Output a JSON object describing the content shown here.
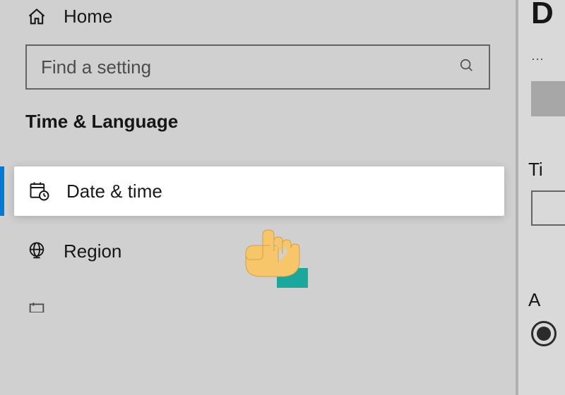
{
  "sidebar": {
    "home_label": "Home",
    "search_placeholder": "Find a setting",
    "section_title": "Time & Language",
    "items": [
      {
        "label": "Date & time"
      },
      {
        "label": "Region"
      }
    ]
  },
  "content": {
    "title_fragment": "D",
    "dotted": "⋯",
    "label_time": "Ti",
    "label_adjust": "A"
  },
  "colors": {
    "accent": "#0078d4"
  }
}
